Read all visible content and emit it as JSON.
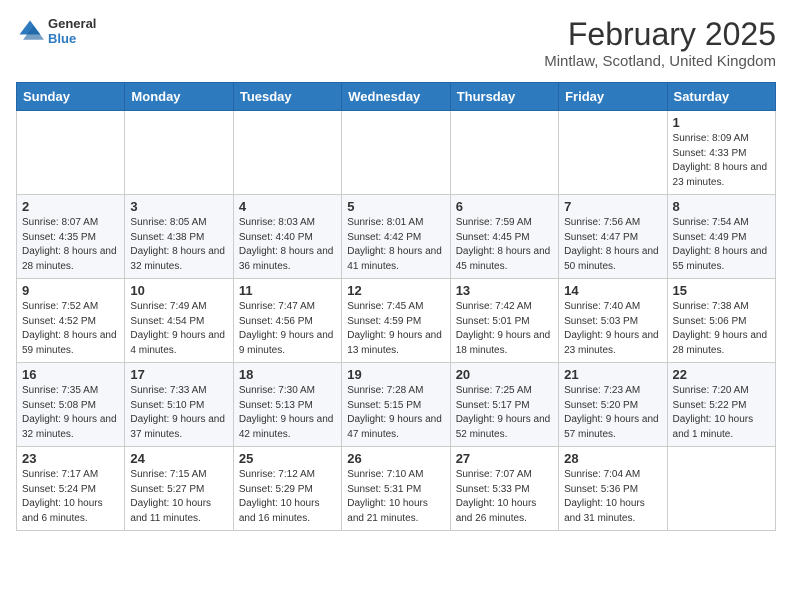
{
  "logo": {
    "general": "General",
    "blue": "Blue"
  },
  "header": {
    "title": "February 2025",
    "location": "Mintlaw, Scotland, United Kingdom"
  },
  "weekdays": [
    "Sunday",
    "Monday",
    "Tuesday",
    "Wednesday",
    "Thursday",
    "Friday",
    "Saturday"
  ],
  "weeks": [
    [
      {
        "day": "",
        "info": ""
      },
      {
        "day": "",
        "info": ""
      },
      {
        "day": "",
        "info": ""
      },
      {
        "day": "",
        "info": ""
      },
      {
        "day": "",
        "info": ""
      },
      {
        "day": "",
        "info": ""
      },
      {
        "day": "1",
        "info": "Sunrise: 8:09 AM\nSunset: 4:33 PM\nDaylight: 8 hours and 23 minutes."
      }
    ],
    [
      {
        "day": "2",
        "info": "Sunrise: 8:07 AM\nSunset: 4:35 PM\nDaylight: 8 hours and 28 minutes."
      },
      {
        "day": "3",
        "info": "Sunrise: 8:05 AM\nSunset: 4:38 PM\nDaylight: 8 hours and 32 minutes."
      },
      {
        "day": "4",
        "info": "Sunrise: 8:03 AM\nSunset: 4:40 PM\nDaylight: 8 hours and 36 minutes."
      },
      {
        "day": "5",
        "info": "Sunrise: 8:01 AM\nSunset: 4:42 PM\nDaylight: 8 hours and 41 minutes."
      },
      {
        "day": "6",
        "info": "Sunrise: 7:59 AM\nSunset: 4:45 PM\nDaylight: 8 hours and 45 minutes."
      },
      {
        "day": "7",
        "info": "Sunrise: 7:56 AM\nSunset: 4:47 PM\nDaylight: 8 hours and 50 minutes."
      },
      {
        "day": "8",
        "info": "Sunrise: 7:54 AM\nSunset: 4:49 PM\nDaylight: 8 hours and 55 minutes."
      }
    ],
    [
      {
        "day": "9",
        "info": "Sunrise: 7:52 AM\nSunset: 4:52 PM\nDaylight: 8 hours and 59 minutes."
      },
      {
        "day": "10",
        "info": "Sunrise: 7:49 AM\nSunset: 4:54 PM\nDaylight: 9 hours and 4 minutes."
      },
      {
        "day": "11",
        "info": "Sunrise: 7:47 AM\nSunset: 4:56 PM\nDaylight: 9 hours and 9 minutes."
      },
      {
        "day": "12",
        "info": "Sunrise: 7:45 AM\nSunset: 4:59 PM\nDaylight: 9 hours and 13 minutes."
      },
      {
        "day": "13",
        "info": "Sunrise: 7:42 AM\nSunset: 5:01 PM\nDaylight: 9 hours and 18 minutes."
      },
      {
        "day": "14",
        "info": "Sunrise: 7:40 AM\nSunset: 5:03 PM\nDaylight: 9 hours and 23 minutes."
      },
      {
        "day": "15",
        "info": "Sunrise: 7:38 AM\nSunset: 5:06 PM\nDaylight: 9 hours and 28 minutes."
      }
    ],
    [
      {
        "day": "16",
        "info": "Sunrise: 7:35 AM\nSunset: 5:08 PM\nDaylight: 9 hours and 32 minutes."
      },
      {
        "day": "17",
        "info": "Sunrise: 7:33 AM\nSunset: 5:10 PM\nDaylight: 9 hours and 37 minutes."
      },
      {
        "day": "18",
        "info": "Sunrise: 7:30 AM\nSunset: 5:13 PM\nDaylight: 9 hours and 42 minutes."
      },
      {
        "day": "19",
        "info": "Sunrise: 7:28 AM\nSunset: 5:15 PM\nDaylight: 9 hours and 47 minutes."
      },
      {
        "day": "20",
        "info": "Sunrise: 7:25 AM\nSunset: 5:17 PM\nDaylight: 9 hours and 52 minutes."
      },
      {
        "day": "21",
        "info": "Sunrise: 7:23 AM\nSunset: 5:20 PM\nDaylight: 9 hours and 57 minutes."
      },
      {
        "day": "22",
        "info": "Sunrise: 7:20 AM\nSunset: 5:22 PM\nDaylight: 10 hours and 1 minute."
      }
    ],
    [
      {
        "day": "23",
        "info": "Sunrise: 7:17 AM\nSunset: 5:24 PM\nDaylight: 10 hours and 6 minutes."
      },
      {
        "day": "24",
        "info": "Sunrise: 7:15 AM\nSunset: 5:27 PM\nDaylight: 10 hours and 11 minutes."
      },
      {
        "day": "25",
        "info": "Sunrise: 7:12 AM\nSunset: 5:29 PM\nDaylight: 10 hours and 16 minutes."
      },
      {
        "day": "26",
        "info": "Sunrise: 7:10 AM\nSunset: 5:31 PM\nDaylight: 10 hours and 21 minutes."
      },
      {
        "day": "27",
        "info": "Sunrise: 7:07 AM\nSunset: 5:33 PM\nDaylight: 10 hours and 26 minutes."
      },
      {
        "day": "28",
        "info": "Sunrise: 7:04 AM\nSunset: 5:36 PM\nDaylight: 10 hours and 31 minutes."
      },
      {
        "day": "",
        "info": ""
      }
    ]
  ]
}
